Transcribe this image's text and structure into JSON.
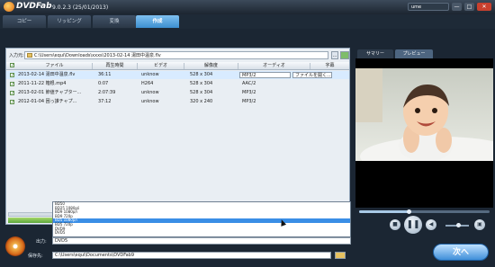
{
  "app": {
    "brand": "DVDFab",
    "version": "9.0.2.3 (25/01/2013)",
    "user_box": "ume"
  },
  "window_controls": [
    "—",
    "□",
    "✕"
  ],
  "tabs": [
    {
      "label": "コピー"
    },
    {
      "label": "リッピング"
    },
    {
      "label": "変換"
    },
    {
      "label": "作成"
    }
  ],
  "input": {
    "label": "入力元:",
    "path": "C:\\Users\\equi\\Downloads\\xxxs\\2013-02-14 湯田中温泉.flv",
    "browse": "..."
  },
  "table": {
    "headers": [
      "ファイル",
      "再生時間",
      "ビデオ",
      "解像度",
      "オーディオ",
      "字幕"
    ],
    "rows": [
      {
        "file": "2013-02-14 湯田中温泉.flv",
        "duration": "36:11",
        "video": "unknow",
        "res": "528 x 304",
        "audio": "MP3/2",
        "sub": "ファイルを開く..."
      },
      {
        "file": "2011-11-22 箱根.mp4",
        "duration": "0:07",
        "video": "H264",
        "res": "528 x 304",
        "audio": "AAC/2",
        "sub": ""
      },
      {
        "file": "2013-02-01 節値チャプター...",
        "duration": "2:07:39",
        "video": "unknow",
        "res": "528 x 304",
        "audio": "MP3/2",
        "sub": ""
      },
      {
        "file": "2012-01-04 困っ誰チャプ...",
        "duration": "37:12",
        "video": "unknow",
        "res": "320 x 240",
        "audio": "MP3/2",
        "sub": ""
      }
    ]
  },
  "progress": 0.6,
  "dropdown": {
    "items": [
      "BD50",
      "BD25 1080p/i",
      "BD9 1080p/i",
      "BD9 720p",
      "BD5 1080p/i",
      "BD5 720p",
      "DVD9",
      "DVD5"
    ],
    "selected_index": 4
  },
  "preview_tabs": [
    "サマリー",
    "プレビュー"
  ],
  "player": {
    "seek": 0.38,
    "volume": 0.55
  },
  "output": {
    "label": "出力:",
    "value": "DVD5"
  },
  "save": {
    "label": "保存先:",
    "path": "C:\\Users\\equi\\Documents\\DVDFab9"
  },
  "next_button": "次へ",
  "colors": {
    "accent": "#3d8fd0",
    "selection": "#3a8ee6",
    "panel": "#e9eef3"
  }
}
